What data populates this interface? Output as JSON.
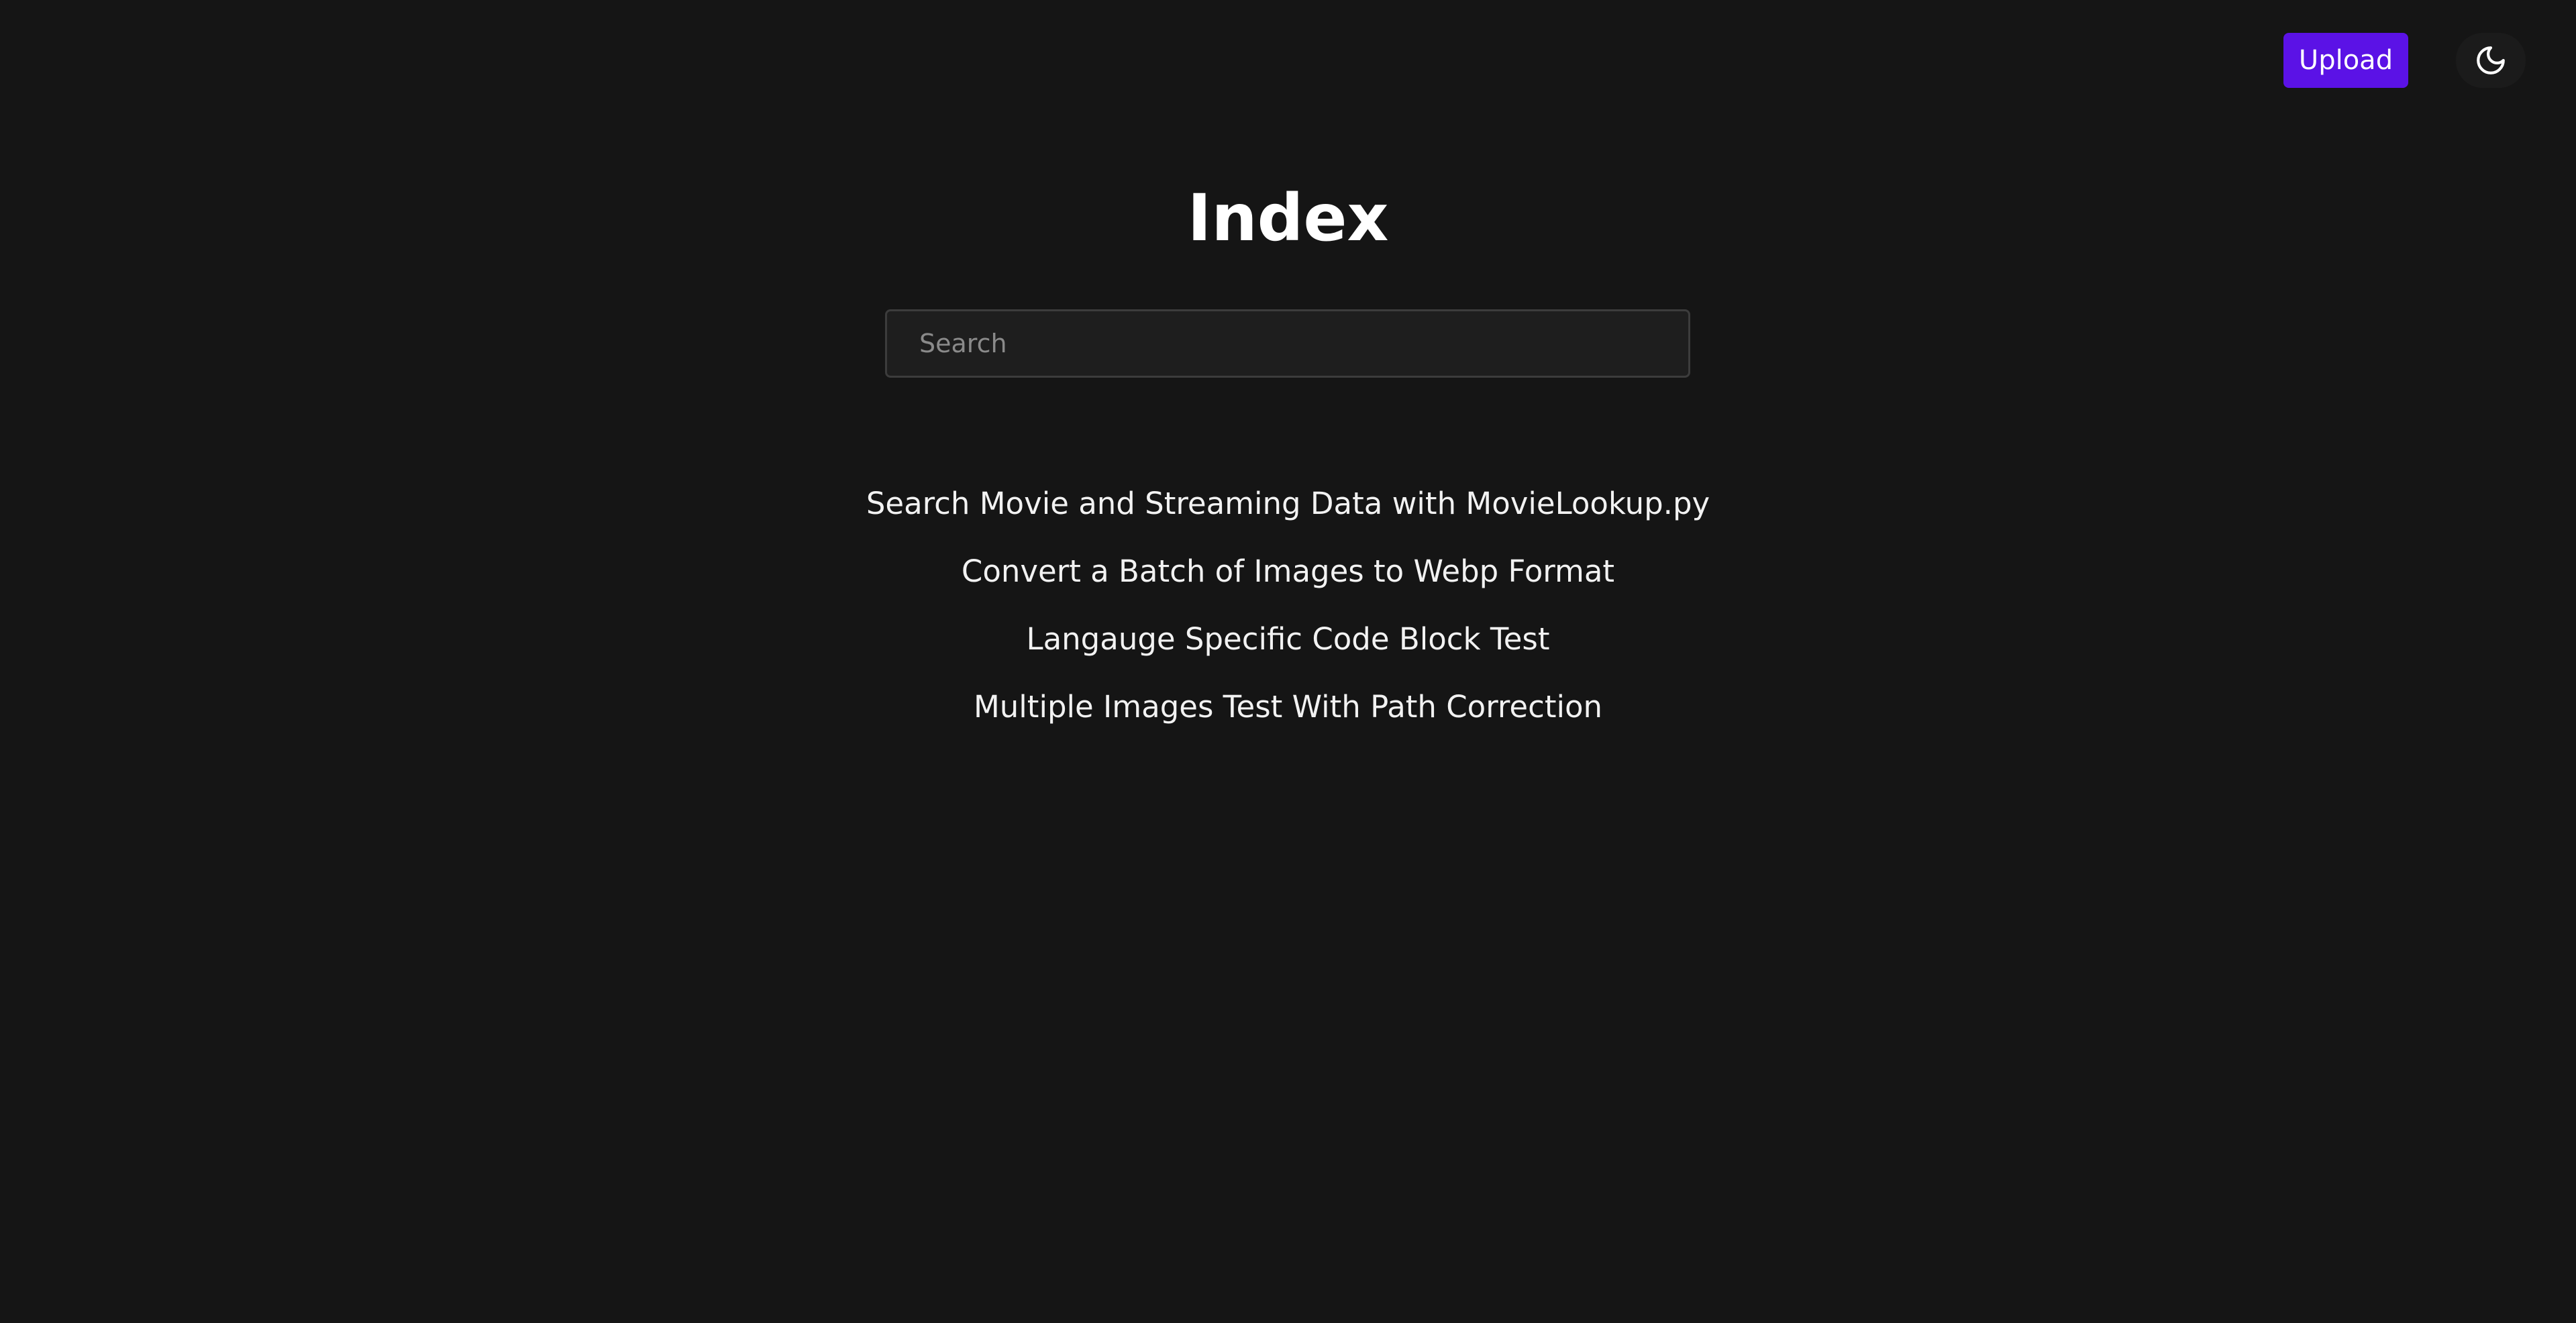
{
  "header": {
    "upload_label": "Upload",
    "theme_toggle_icon": "moon-icon"
  },
  "main": {
    "title": "Index",
    "search": {
      "placeholder": "Search",
      "value": ""
    },
    "posts": [
      {
        "title": "Search Movie and Streaming Data with MovieLookup.py"
      },
      {
        "title": "Convert a Batch of Images to Webp Format"
      },
      {
        "title": "Langauge Specific Code Block Test"
      },
      {
        "title": "Multiple Images Test With Path Correction"
      }
    ]
  },
  "colors": {
    "background": "#151515",
    "accent": "#5b12e6",
    "text": "#ffffff"
  }
}
